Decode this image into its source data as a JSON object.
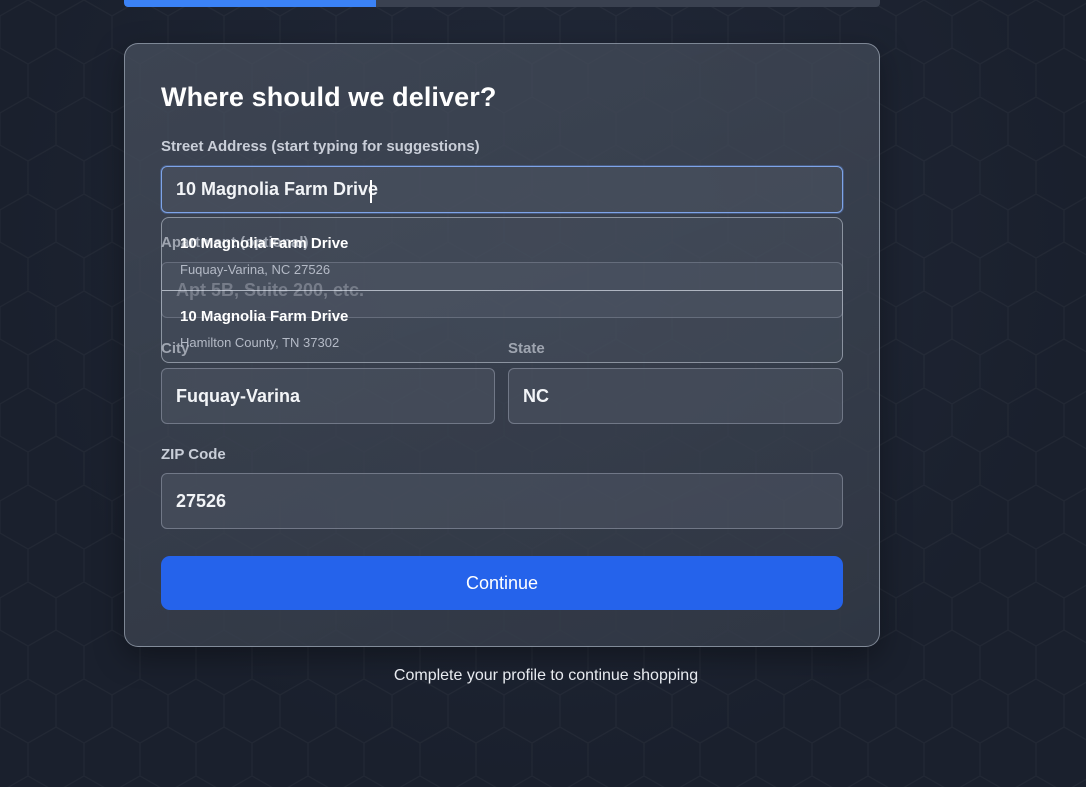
{
  "progress": {
    "fraction": 0.333
  },
  "form": {
    "title": "Where should we deliver?",
    "street": {
      "label": "Street Address (start typing for suggestions)",
      "value": "10 Magnolia Farm Drive"
    },
    "apartment": {
      "label": "Apartment (optional)",
      "placeholder": "Apt 5B, Suite 200, etc."
    },
    "city": {
      "label": "City",
      "value": "Fuquay-Varina"
    },
    "state": {
      "label": "State",
      "value": "NC"
    },
    "zip": {
      "label": "ZIP Code",
      "value": "27526"
    },
    "continue_label": "Continue"
  },
  "suggestions": [
    {
      "main": "10 Magnolia Farm Drive",
      "sub": "Fuquay-Varina, NC 27526"
    },
    {
      "main": "10 Magnolia Farm Drive",
      "sub": "Hamilton County, TN 37302"
    }
  ],
  "footer_text": "Complete your profile to continue shopping",
  "colors": {
    "accent": "#2563eb",
    "progress": "#3b82f6"
  }
}
